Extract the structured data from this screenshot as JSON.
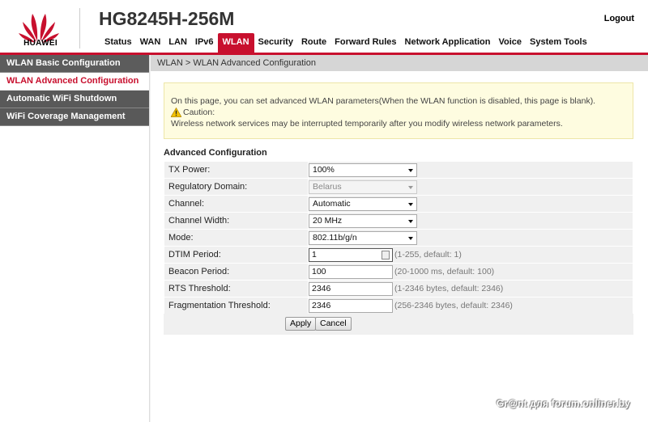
{
  "header": {
    "brand": "HUAWEI",
    "device_title": "HG8245H-256M",
    "logout_label": "Logout",
    "brand_color": "#c8102e",
    "nav": [
      {
        "label": "Status"
      },
      {
        "label": "WAN"
      },
      {
        "label": "LAN"
      },
      {
        "label": "IPv6"
      },
      {
        "label": "WLAN",
        "active": true
      },
      {
        "label": "Security"
      },
      {
        "label": "Route"
      },
      {
        "label": "Forward Rules"
      },
      {
        "label": "Network Application"
      },
      {
        "label": "Voice"
      },
      {
        "label": "System Tools"
      }
    ]
  },
  "sidebar": {
    "items": [
      {
        "label": "WLAN Basic Configuration"
      },
      {
        "label": "WLAN Advanced Configuration",
        "active": true
      },
      {
        "label": "Automatic WiFi Shutdown"
      },
      {
        "label": "WiFi Coverage Management"
      }
    ]
  },
  "breadcrumb": "WLAN > WLAN Advanced Configuration",
  "notice": {
    "line1": "On this page, you can set advanced WLAN parameters(When the WLAN function is disabled, this page is blank).",
    "caution_label": "Caution:",
    "caution_icon": "warning-icon",
    "line3": "Wireless network services may be interrupted temporarily after you modify wireless network parameters."
  },
  "config": {
    "title": "Advanced Configuration",
    "tx_power": {
      "label": "TX Power:",
      "value": "100%"
    },
    "regulatory_domain": {
      "label": "Regulatory Domain:",
      "value": "Belarus",
      "disabled": true
    },
    "channel": {
      "label": "Channel:",
      "value": "Automatic"
    },
    "channel_width": {
      "label": "Channel Width:",
      "value": "20 MHz"
    },
    "mode": {
      "label": "Mode:",
      "value": "802.11b/g/n"
    },
    "dtim_period": {
      "label": "DTIM Period:",
      "value": "1",
      "hint": "(1-255, default: 1)"
    },
    "beacon_period": {
      "label": "Beacon Period:",
      "value": "100",
      "hint": "(20-1000 ms, default: 100)"
    },
    "rts_threshold": {
      "label": "RTS Threshold:",
      "value": "2346",
      "hint": "(1-2346 bytes, default: 2346)"
    },
    "fragmentation_threshold": {
      "label": "Fragmentation Threshold:",
      "value": "2346",
      "hint": "(256-2346 bytes, default: 2346)"
    }
  },
  "buttons": {
    "apply": "Apply",
    "cancel": "Cancel"
  },
  "watermark": "Gr@nt для forum.onliner.by"
}
